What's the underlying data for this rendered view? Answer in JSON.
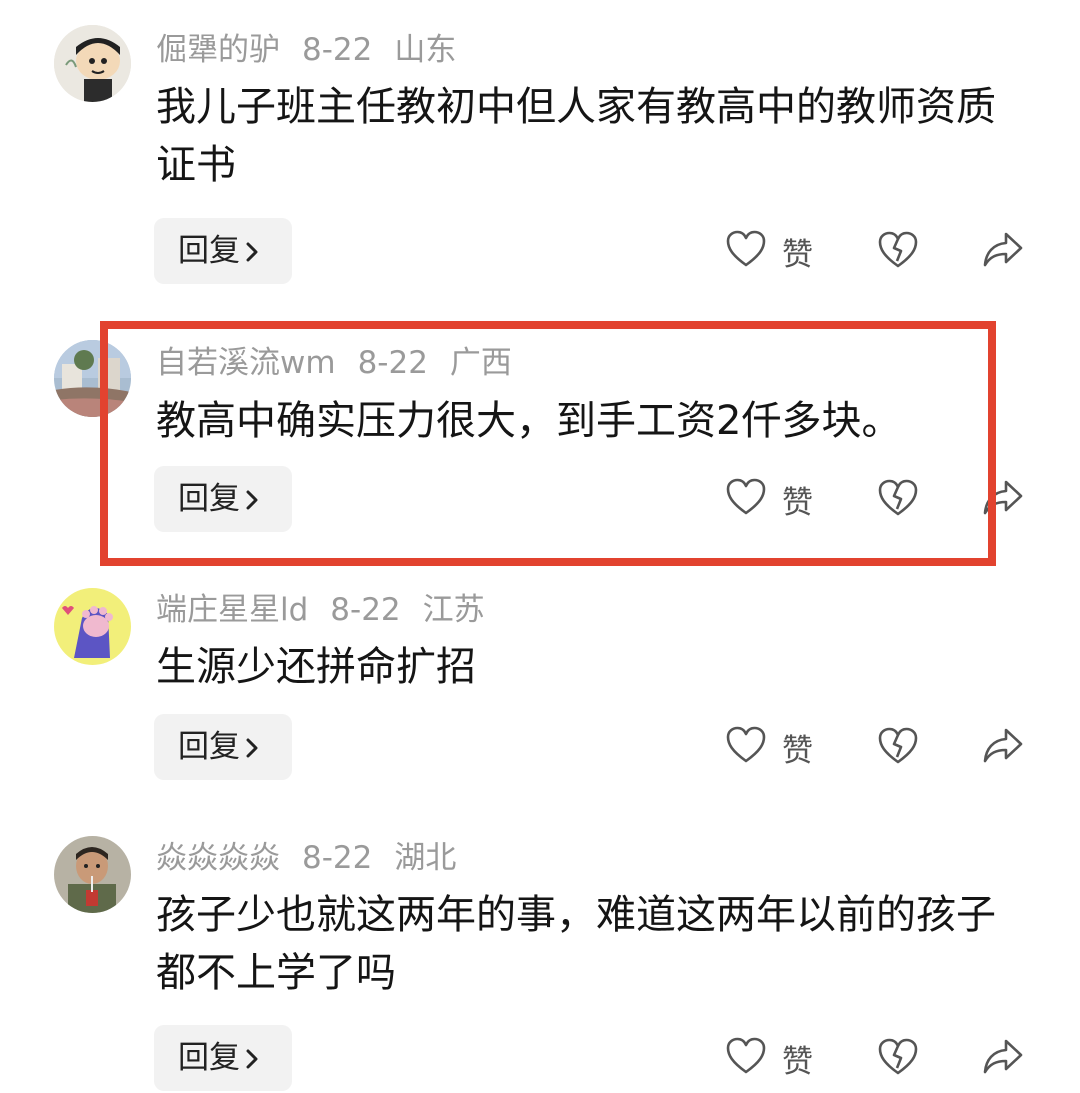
{
  "comments": [
    {
      "username": "倔犟的驴",
      "date": "8-22",
      "location": "山东",
      "text": "我儿子班主任教初中但人家有教高中的教师资质证书",
      "reply_label": "回复",
      "like_label": "赞"
    },
    {
      "username": "自若溪流wm",
      "date": "8-22",
      "location": "广西",
      "text": "教高中确实压力很大，到手工资2仟多块。",
      "reply_label": "回复",
      "like_label": "赞"
    },
    {
      "username": "端庄星星ld",
      "date": "8-22",
      "location": "江苏",
      "text": "生源少还拼命扩招",
      "reply_label": "回复",
      "like_label": "赞"
    },
    {
      "username": "焱焱焱焱",
      "date": "8-22",
      "location": "湖北",
      "text": "孩子少也就这两年的事，难道这两年以前的孩子都不上学了吗",
      "reply_label": "回复",
      "like_label": "赞"
    }
  ],
  "icons": {
    "like": "heart-icon",
    "dislike": "broken-heart-icon",
    "share": "share-arrow-icon",
    "reply_chevron": "chevron-right-icon"
  },
  "colors": {
    "highlight_border": "#e2432f",
    "meta_text": "#9a9a9a",
    "reply_bg": "#f2f2f2"
  }
}
